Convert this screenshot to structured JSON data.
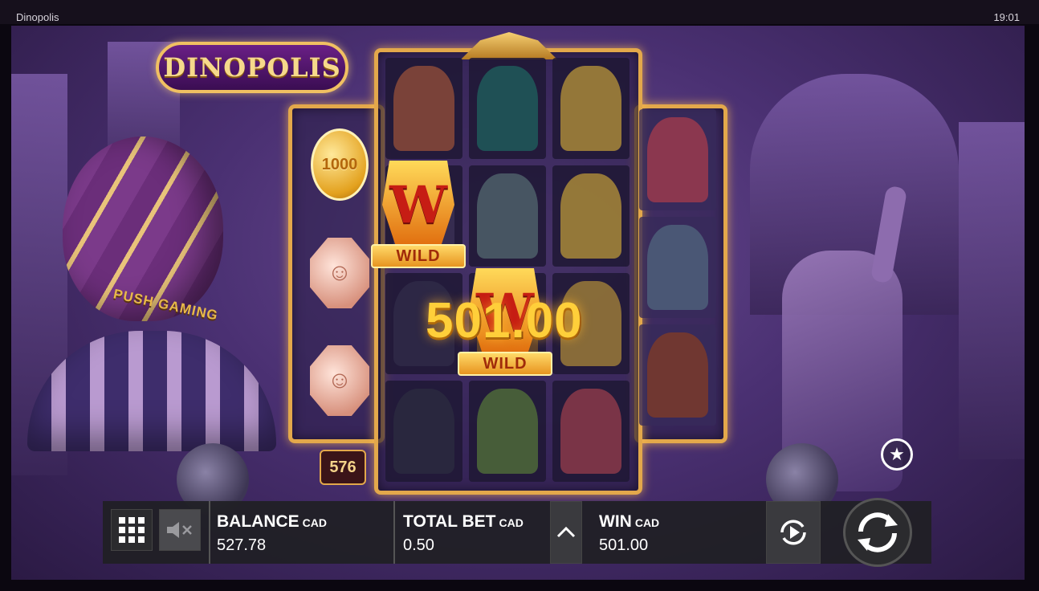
{
  "window": {
    "title": "Dinopolis",
    "clock": "19:01"
  },
  "game": {
    "logo": "DINOPOLIS",
    "background_sign": "PUSH GAMING",
    "coins": [
      {
        "type": "gold",
        "label": "1000"
      },
      {
        "type": "copper",
        "label": "☺"
      },
      {
        "type": "copper",
        "label": "☺"
      }
    ],
    "ways_count": "576",
    "wild_letter": "W",
    "wild_label": "WILD",
    "win_display": "501.00",
    "favourite_icon": "star-icon"
  },
  "controls": {
    "menu_icon": "grid-menu-icon",
    "sound_icon": "speaker-muted-icon",
    "balance_label": "BALANCE",
    "balance_currency": "CAD",
    "balance_value": "527.78",
    "total_bet_label": "TOTAL BET",
    "total_bet_currency": "CAD",
    "total_bet_value": "0.50",
    "bet_toggle_icon": "chevron-up-icon",
    "win_label": "WIN",
    "win_currency": "CAD",
    "win_value": "501.00",
    "autoplay_icon": "autoplay-icon",
    "spin_icon": "spin-icon"
  }
}
